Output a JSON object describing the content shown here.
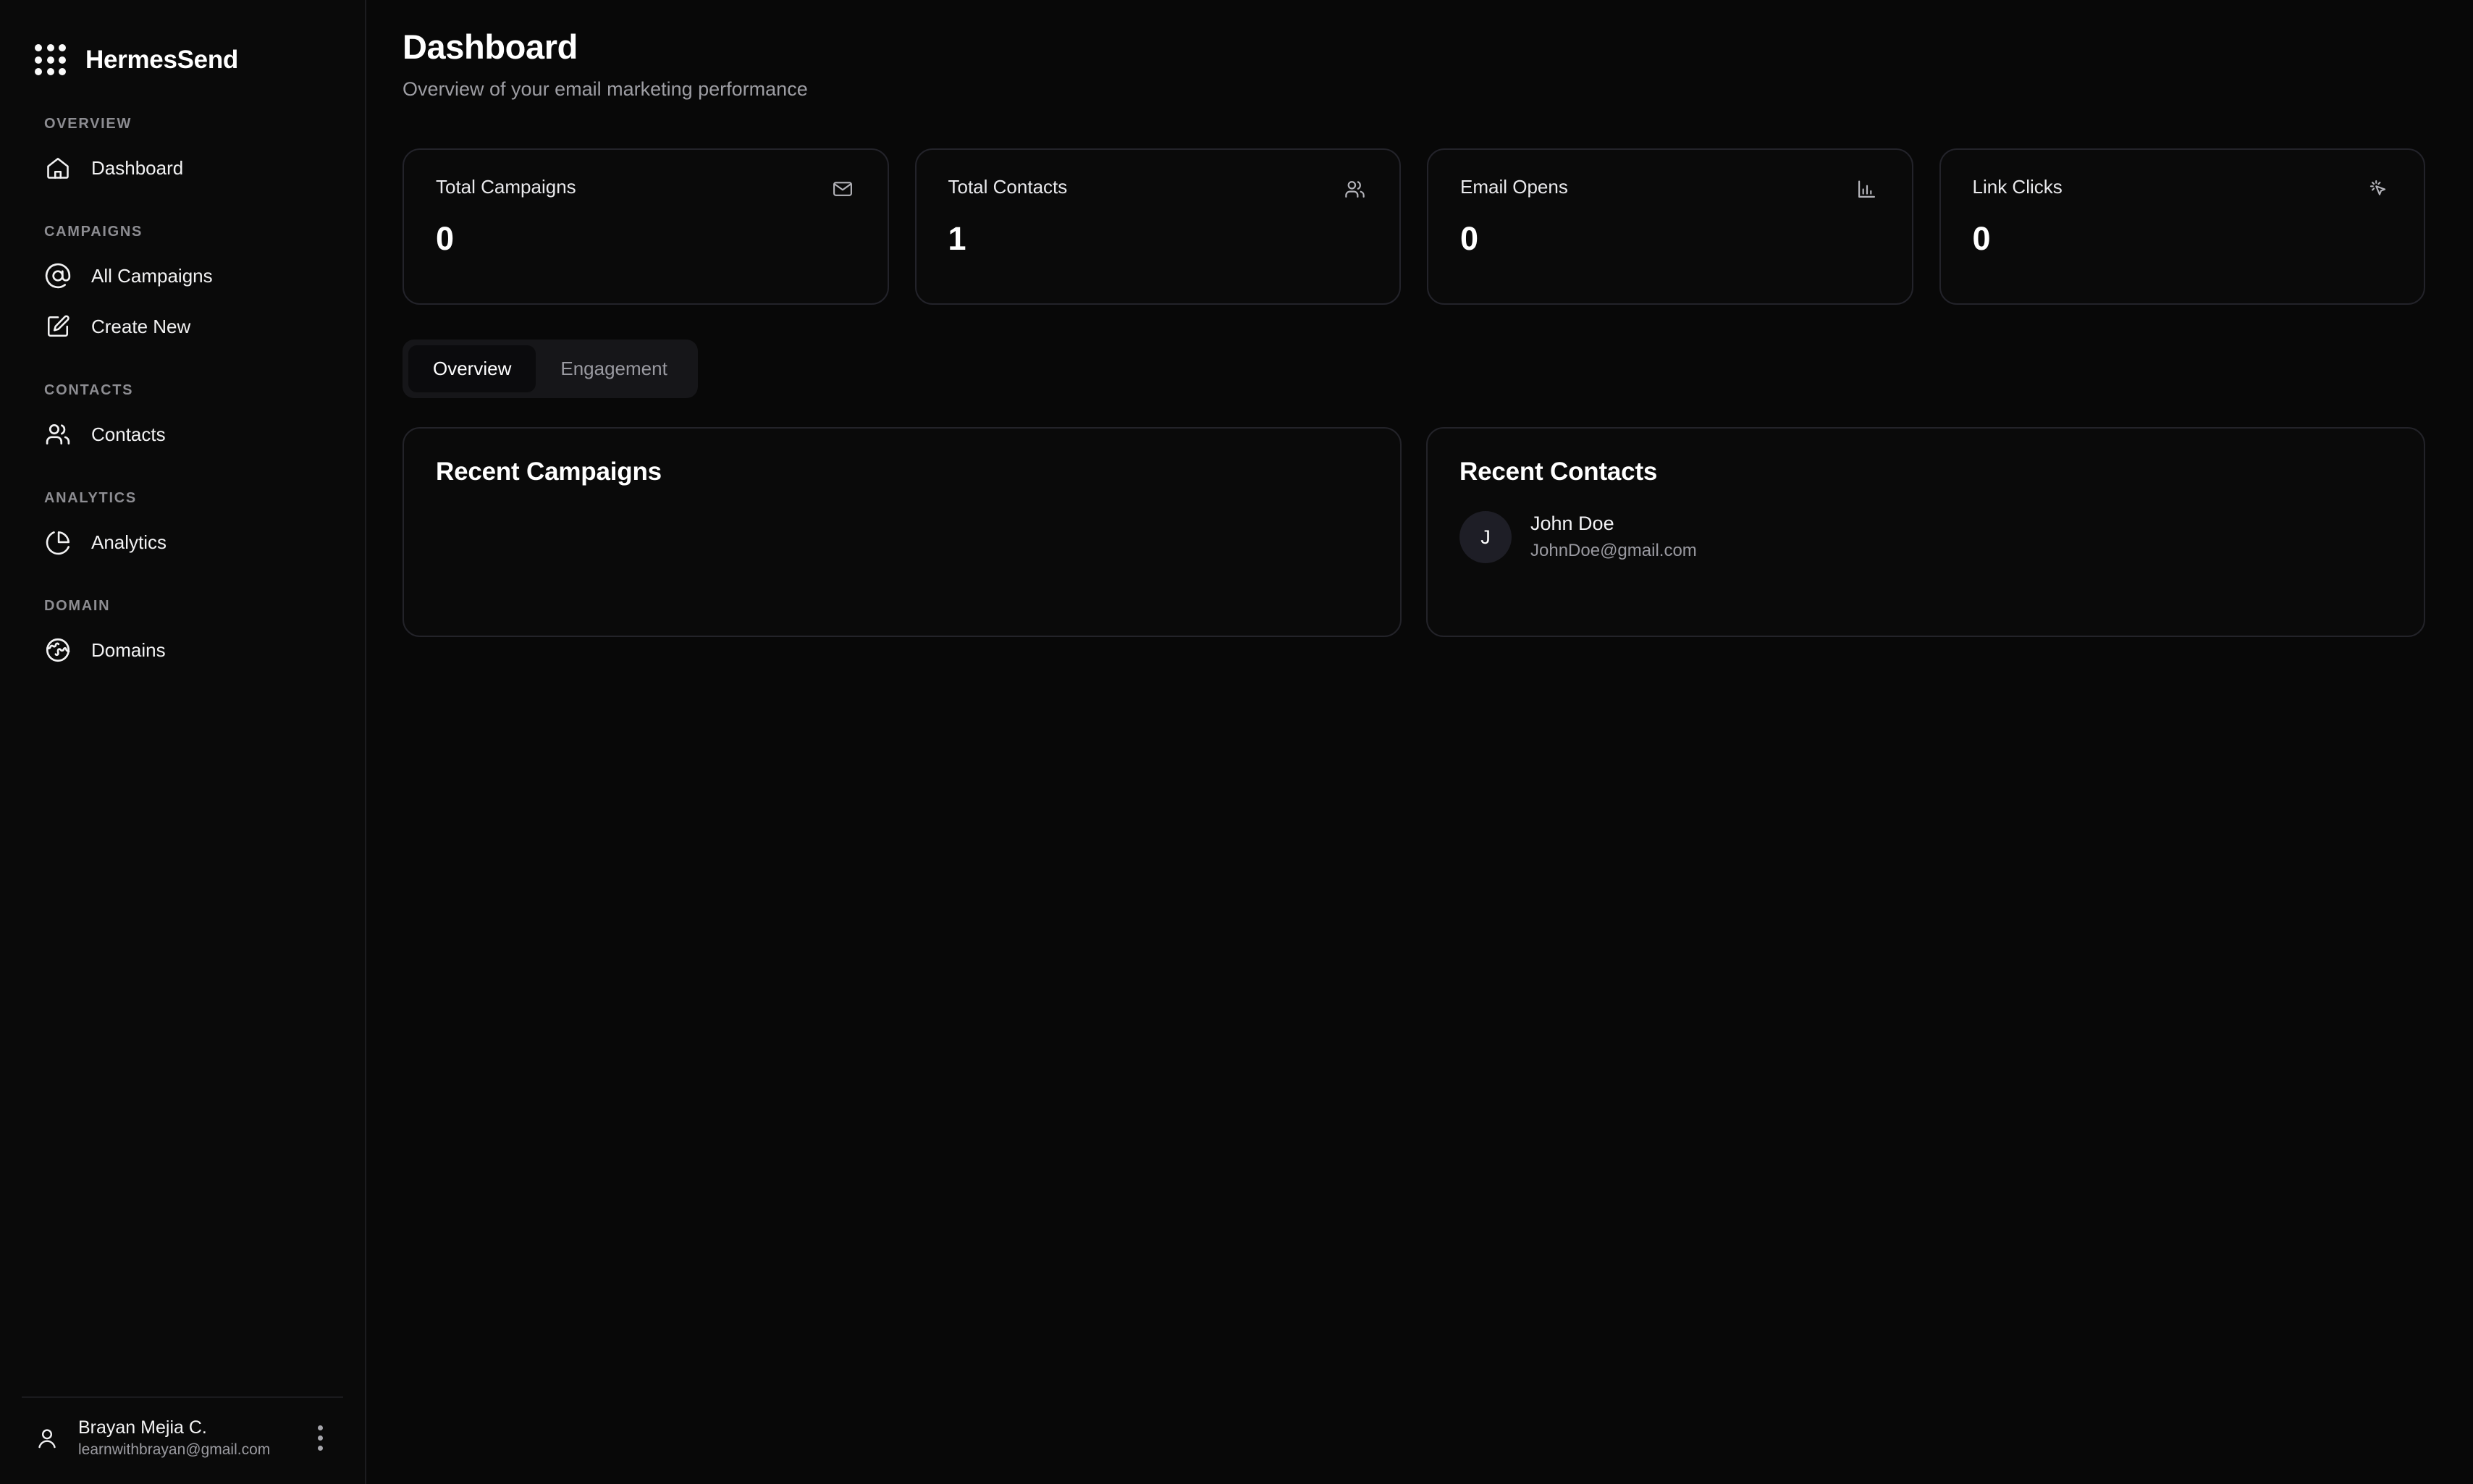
{
  "brand": {
    "name": "HermesSend",
    "logo_icon": "grid-dots-icon"
  },
  "sidebar": {
    "sections": [
      {
        "label": "OVERVIEW",
        "items": [
          {
            "label": "Dashboard",
            "icon": "home-icon"
          }
        ]
      },
      {
        "label": "CAMPAIGNS",
        "items": [
          {
            "label": "All Campaigns",
            "icon": "at-sign-icon"
          },
          {
            "label": "Create New",
            "icon": "square-pen-icon"
          }
        ]
      },
      {
        "label": "CONTACTS",
        "items": [
          {
            "label": "Contacts",
            "icon": "users-icon"
          }
        ]
      },
      {
        "label": "ANALYTICS",
        "items": [
          {
            "label": "Analytics",
            "icon": "pie-chart-icon"
          }
        ]
      },
      {
        "label": "DOMAIN",
        "items": [
          {
            "label": "Domains",
            "icon": "globe-icon"
          }
        ]
      }
    ],
    "user": {
      "name": "Brayan Mejia C.",
      "email": "learnwithbrayan@gmail.com",
      "avatar_icon": "user-icon",
      "more_icon": "more-vertical-icon"
    }
  },
  "header": {
    "title": "Dashboard",
    "subtitle": "Overview of your email marketing performance"
  },
  "stats": [
    {
      "label": "Total Campaigns",
      "value": "0",
      "icon": "mail-icon"
    },
    {
      "label": "Total Contacts",
      "value": "1",
      "icon": "users-icon"
    },
    {
      "label": "Email Opens",
      "value": "0",
      "icon": "bar-chart-icon"
    },
    {
      "label": "Link Clicks",
      "value": "0",
      "icon": "mouse-pointer-click-icon"
    }
  ],
  "tabs": [
    {
      "label": "Overview",
      "active": true
    },
    {
      "label": "Engagement",
      "active": false
    }
  ],
  "panels": {
    "recent_campaigns": {
      "title": "Recent Campaigns",
      "items": []
    },
    "recent_contacts": {
      "title": "Recent Contacts",
      "items": [
        {
          "initial": "J",
          "name": "John Doe",
          "email": "JohnDoe@gmail.com"
        }
      ]
    }
  },
  "colors": {
    "page_bg": "#080808",
    "panel_bg": "#0a0a0a",
    "border": "#23232a",
    "text_primary": "#ffffff",
    "text_muted": "#9a9aa1",
    "tab_track": "#161619"
  }
}
